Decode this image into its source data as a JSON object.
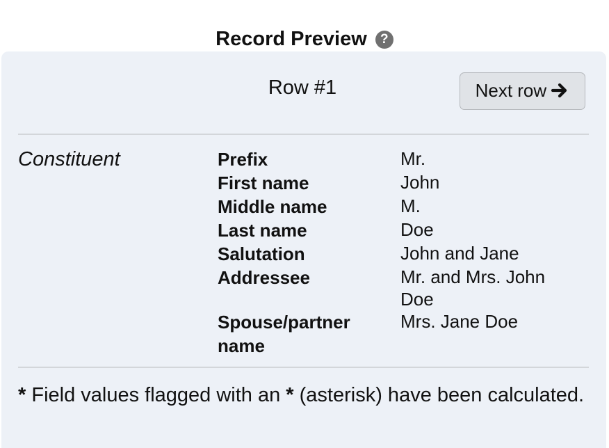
{
  "header": {
    "title": "Record Preview",
    "help_icon_glyph": "?"
  },
  "preview": {
    "row_label": "Row #1",
    "next_button_label": "Next row"
  },
  "section": {
    "label": "Constituent",
    "fields": [
      {
        "label": "Prefix",
        "value": "Mr."
      },
      {
        "label": "First name",
        "value": "John"
      },
      {
        "label": "Middle name",
        "value": "M."
      },
      {
        "label": "Last name",
        "value": "Doe"
      },
      {
        "label": "Salutation",
        "value": "John and Jane"
      },
      {
        "label": "Addressee",
        "value": "Mr. and Mrs. John Doe"
      },
      {
        "label": "Spouse/partner name",
        "value": "Mrs. Jane Doe"
      }
    ]
  },
  "footer": {
    "asterisk_1": "*",
    "text_1": " Field values flagged with an ",
    "asterisk_2": "*",
    "text_2": " (asterisk) have been calculated."
  }
}
